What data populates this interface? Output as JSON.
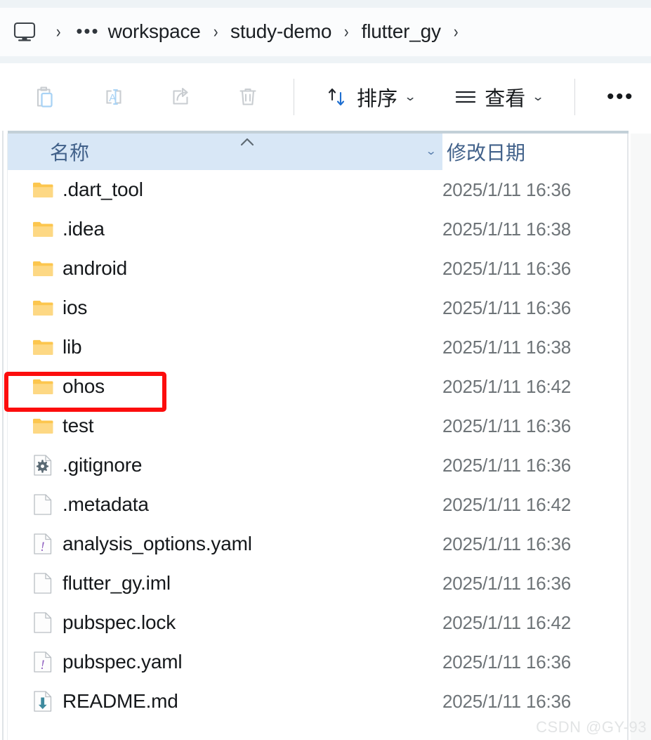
{
  "window": {
    "kind": "file-explorer"
  },
  "addressbar": {
    "pc_icon": "monitor-icon",
    "separator": "›",
    "ellipsis": "•••",
    "crumbs": [
      "workspace",
      "study-demo",
      "flutter_gy"
    ]
  },
  "toolbar": {
    "icon_buttons": [
      {
        "name": "paste-button",
        "icon": "clipboard-paste-icon"
      },
      {
        "name": "rename-button",
        "icon": "rename-icon"
      },
      {
        "name": "share-button",
        "icon": "share-icon"
      },
      {
        "name": "delete-button",
        "icon": "trash-icon"
      }
    ],
    "sort_label": "排序",
    "view_label": "查看",
    "chevron": "⌄",
    "overflow_label": "•••"
  },
  "columns": {
    "name_label": "名称",
    "date_label": "修改日期",
    "sort_direction": "ascending",
    "dropdown_chevron": "⌄",
    "header_bg": "#d8e7f6",
    "header_text_color": "#41618a"
  },
  "files": [
    {
      "name": ".dart_tool",
      "icon": "folder-icon",
      "date": "2025/1/11 16:36",
      "highlighted": false
    },
    {
      "name": ".idea",
      "icon": "folder-icon",
      "date": "2025/1/11 16:38",
      "highlighted": false
    },
    {
      "name": "android",
      "icon": "folder-icon",
      "date": "2025/1/11 16:36",
      "highlighted": false
    },
    {
      "name": "ios",
      "icon": "folder-icon",
      "date": "2025/1/11 16:36",
      "highlighted": false
    },
    {
      "name": "lib",
      "icon": "folder-icon",
      "date": "2025/1/11 16:38",
      "highlighted": false
    },
    {
      "name": "ohos",
      "icon": "folder-icon",
      "date": "2025/1/11 16:42",
      "highlighted": true
    },
    {
      "name": "test",
      "icon": "folder-icon",
      "date": "2025/1/11 16:36",
      "highlighted": false
    },
    {
      "name": ".gitignore",
      "icon": "config-file-icon",
      "date": "2025/1/11 16:36",
      "highlighted": false
    },
    {
      "name": ".metadata",
      "icon": "blank-file-icon",
      "date": "2025/1/11 16:42",
      "highlighted": false
    },
    {
      "name": "analysis_options.yaml",
      "icon": "yaml-file-icon",
      "date": "2025/1/11 16:36",
      "highlighted": false
    },
    {
      "name": "flutter_gy.iml",
      "icon": "blank-file-icon",
      "date": "2025/1/11 16:36",
      "highlighted": false
    },
    {
      "name": "pubspec.lock",
      "icon": "blank-file-icon",
      "date": "2025/1/11 16:42",
      "highlighted": false
    },
    {
      "name": "pubspec.yaml",
      "icon": "yaml-file-icon",
      "date": "2025/1/11 16:36",
      "highlighted": false
    },
    {
      "name": "README.md",
      "icon": "markdown-file-icon",
      "date": "2025/1/11 16:36",
      "highlighted": false
    }
  ],
  "annotation": {
    "color": "#fc0d0d",
    "target": "ohos"
  },
  "watermark": {
    "text": "CSDN @GY-93"
  }
}
